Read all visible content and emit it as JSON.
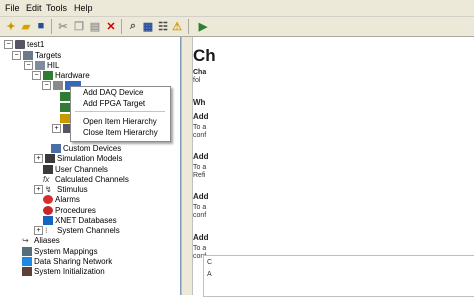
{
  "menubar": {
    "items": [
      "File",
      "Edit",
      "Tools",
      "Help"
    ]
  },
  "tree": {
    "root": "test1",
    "targets": "Targets",
    "hil": "HIL",
    "hardware": "Hardware",
    "custom_devices": "Custom Devices",
    "simulation_models": "Simulation Models",
    "user_channels": "User Channels",
    "calculated_channels": "Calculated Channels",
    "stimulus": "Stimulus",
    "alarms": "Alarms",
    "procedures": "Procedures",
    "xnet_databases": "XNET Databases",
    "system_channels": "System Channels",
    "aliases": "Aliases",
    "system_mappings": "System Mappings",
    "data_sharing_network": "Data Sharing Network",
    "system_initialization": "System Initialization"
  },
  "context_menu": {
    "add_daq": "Add DAQ Device",
    "add_fpga": "Add FPGA Target",
    "open_hierarchy": "Open Item Hierarchy",
    "close_hierarchy": "Close Item Hierarchy"
  },
  "detail": {
    "title": "Ch",
    "subtitle": "Cha",
    "subtitle2": "fol",
    "h1": "Wh",
    "sec1_title": "Add",
    "sec1_line1": "To a",
    "sec1_line2": "conf",
    "sec2_title": "Add",
    "sec2_line1": "To a",
    "sec2_line2": "Refi",
    "sec3_title": "Add",
    "sec3_line1": "To a",
    "sec3_line2": "conf",
    "sec4_title": "Add",
    "sec4_line1": "To a",
    "sec4_line2": "conf",
    "bottom1": "C",
    "bottom2": "A"
  }
}
